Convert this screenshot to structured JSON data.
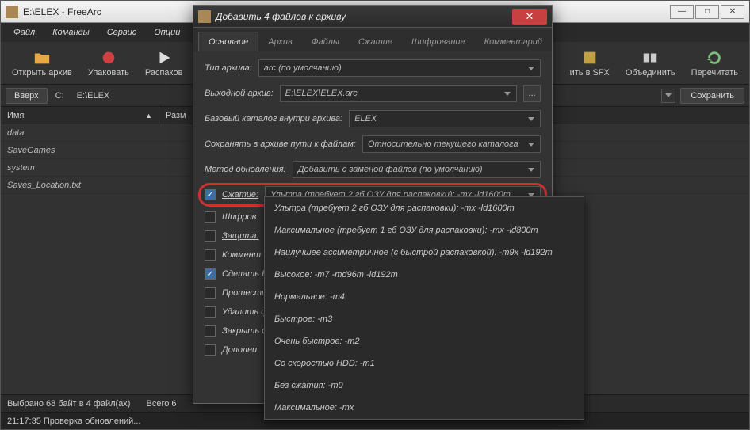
{
  "main": {
    "title": "E:\\ELEX - FreeArc",
    "menu": [
      "Файл",
      "Команды",
      "Сервис",
      "Опции"
    ],
    "toolbar": [
      {
        "icon": "folder",
        "label": "Открыть архив"
      },
      {
        "icon": "record",
        "label": "Упаковать"
      },
      {
        "icon": "play",
        "label": "Распаков"
      },
      {
        "icon": "sfx",
        "label": "ить в SFX"
      },
      {
        "icon": "merge",
        "label": "Объединить"
      },
      {
        "icon": "reload",
        "label": "Перечитать"
      }
    ],
    "path": {
      "up": "Вверх",
      "drive": "C:",
      "loc": "E:\\ELEX",
      "save": "Сохранить"
    },
    "cols": {
      "name": "Имя",
      "size": "Разм"
    },
    "files": [
      "data",
      "SaveGames",
      "system",
      "Saves_Location.txt"
    ],
    "status1": {
      "sel": "Выбрано 68 байт в 4 файл(ах)",
      "total": "Всего 6"
    },
    "status2": "21:17:35 Проверка обновлений..."
  },
  "dlg": {
    "title": "Добавить 4 файлов к архиву",
    "tabs": [
      "Основное",
      "Архив",
      "Файлы",
      "Сжатие",
      "Шифрование",
      "Комментарий"
    ],
    "rows": {
      "type_lbl": "Тип архива:",
      "type_val": "arc (по умолчанию)",
      "out_lbl": "Выходной архив:",
      "out_val": "E:\\ELEX\\ELEX.arc",
      "base_lbl": "Базовый каталог внутри архива:",
      "base_val": "ELEX",
      "save_lbl": "Сохранять в архиве пути к файлам:",
      "save_val": "Относительно текущего каталога",
      "upd_lbl": "Метод обновления:",
      "upd_val": "Добавить с заменой файлов (по умолчанию)",
      "comp_lbl": "Сжатие:",
      "comp_val": "Ультра (требует 2 гб ОЗУ для распаковки): -mx -ld1600m",
      "enc_lbl": "Шифров",
      "prot_lbl": "Защита:",
      "comm_lbl": "Коммент",
      "exe_lbl": "Сделать E",
      "test_lbl": "Протести",
      "del_lbl": "Удалить ф",
      "close_lbl": "Закрыть с",
      "extra_lbl": "Дополни"
    }
  },
  "dropdown": [
    "Ультра (требует 2 гб ОЗУ для распаковки): -mx -ld1600m",
    "Максимальное (требует 1 гб ОЗУ для распаковки): -mx -ld800m",
    "Наилучшее ассиметричное (с быстрой распаковкой): -m9x -ld192m",
    "Высокое: -m7 -md96m -ld192m",
    "Нормальное: -m4",
    "Быстрое: -m3",
    "Очень быстрое: -m2",
    "Со скоростью HDD: -m1",
    "Без сжатия: -m0",
    "Максимальное: -mx"
  ]
}
